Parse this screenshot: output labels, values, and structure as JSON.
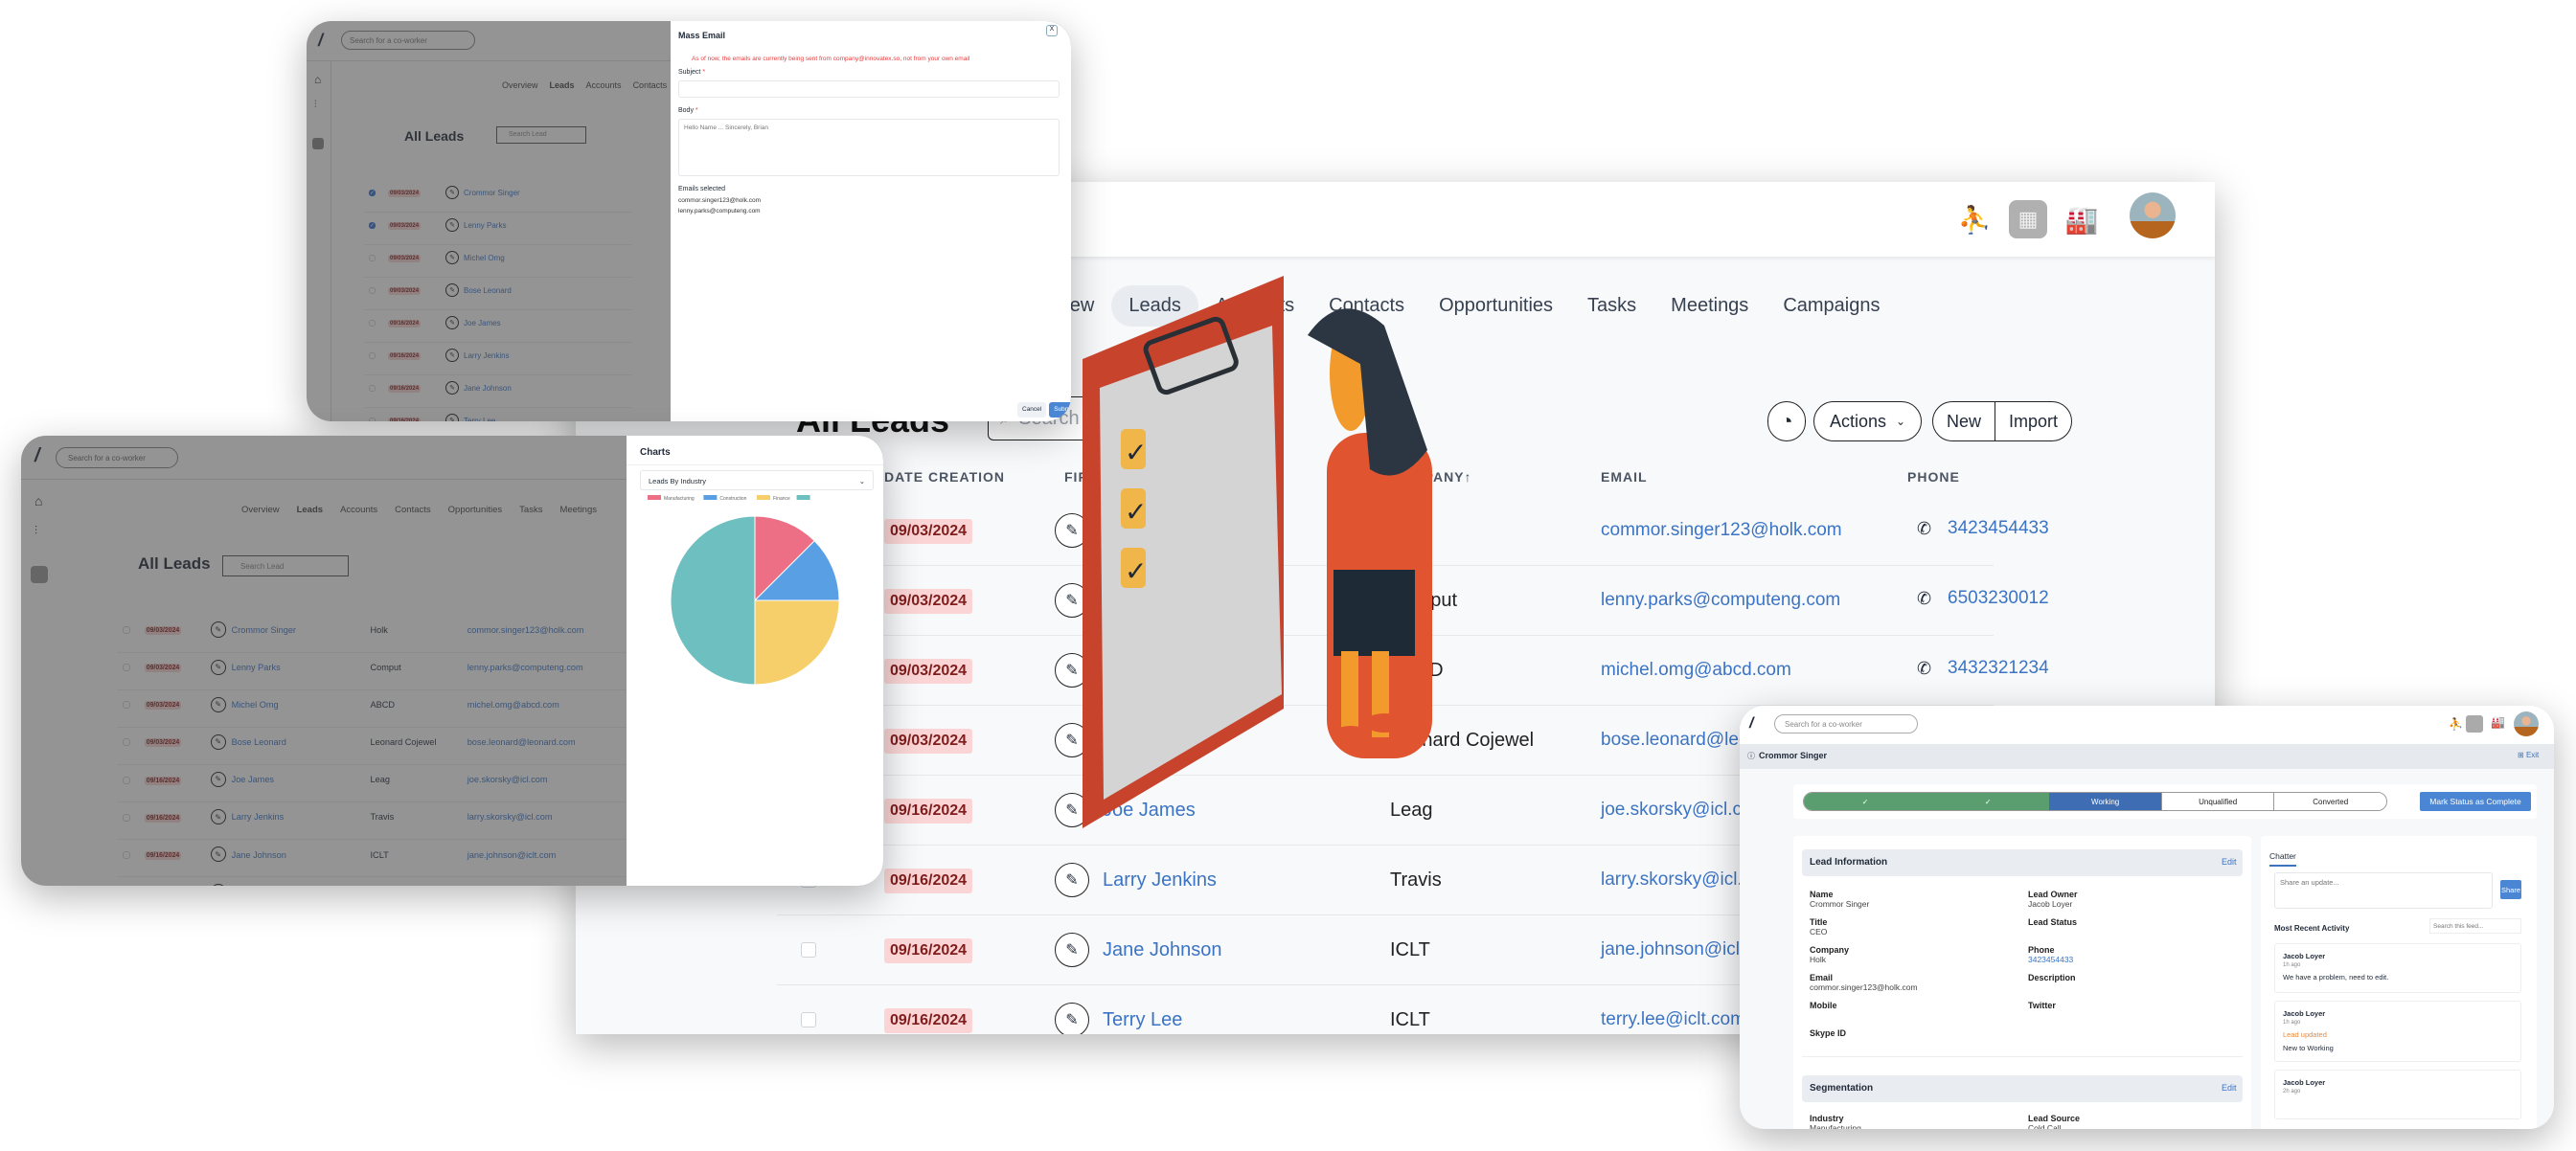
{
  "main_window": {
    "header_icons": [
      "hand-person-icon",
      "analytics-icon",
      "factory-icon",
      "user-avatar"
    ],
    "nav_tabs": [
      {
        "label": "Overview",
        "active": false
      },
      {
        "label": "Leads",
        "active": true
      },
      {
        "label": "Accounts",
        "active": false
      },
      {
        "label": "Contacts",
        "active": false
      },
      {
        "label": "Opportunities",
        "active": false
      },
      {
        "label": "Tasks",
        "active": false
      },
      {
        "label": "Meetings",
        "active": false
      },
      {
        "label": "Campaigns",
        "active": false
      }
    ],
    "list_title": "All Leads",
    "search_placeholder": "Search Lead",
    "actions_label": "Actions",
    "new_label": "New",
    "import_label": "Import",
    "columns": [
      "DATE CREATION",
      "FIRST NAME",
      "COMPANY",
      "EMAIL",
      "PHONE"
    ],
    "sort_indicator": "↑",
    "rows": [
      {
        "date": "09/03/2024",
        "name": "Crommor Singer",
        "company": "Holk",
        "email": "commor.singer123@holk.com",
        "phone": "3423454433",
        "checked": true
      },
      {
        "date": "09/03/2024",
        "name": "Lenny Parks",
        "company": "Comput",
        "email": "lenny.parks@computeng.com",
        "phone": "6503230012",
        "checked": true
      },
      {
        "date": "09/03/2024",
        "name": "Michel Omg",
        "company": "ABCD",
        "email": "michel.omg@abcd.com",
        "phone": "3432321234",
        "checked": false
      },
      {
        "date": "09/03/2024",
        "name": "Bose Leonard",
        "company": "Leonard Cojewel",
        "email": "bose.leonard@leonard.com",
        "phone": "",
        "checked": false
      },
      {
        "date": "09/16/2024",
        "name": "Joe James",
        "company": "Leag",
        "email": "joe.skorsky@icl.com",
        "phone": "",
        "checked": false
      },
      {
        "date": "09/16/2024",
        "name": "Larry Jenkins",
        "company": "Travis",
        "email": "larry.skorsky@icl.com",
        "phone": "",
        "checked": false
      },
      {
        "date": "09/16/2024",
        "name": "Jane Johnson",
        "company": "ICLT",
        "email": "jane.johnson@iclt.com",
        "phone": "",
        "checked": false
      },
      {
        "date": "09/16/2024",
        "name": "Terry Lee",
        "company": "ICLT",
        "email": "terry.lee@iclt.com",
        "phone": "",
        "checked": false
      }
    ]
  },
  "coworker_search_placeholder": "Search for a co-worker",
  "mass_email": {
    "title": "Mass Email",
    "close_label": "X",
    "warning": "As of now, the emails are currently being sent from company@innovatex.so, not from your own email",
    "subject_label": "Subject",
    "body_label": "Body",
    "required_mark": "*",
    "body_placeholder": "Hello Name ... Sincerely, Brian",
    "emails_selected_label": "Emails selected",
    "emails_selected": [
      "commor.singer123@holk.com",
      "lenny.parks@computeng.com"
    ],
    "cancel_label": "Cancel",
    "submit_label": "Submit"
  },
  "charts_panel": {
    "title": "Charts",
    "select_value": "Leads By Industry"
  },
  "chart_data": {
    "type": "pie",
    "title": "Leads By Industry",
    "categories": [
      "Manufacturing",
      "Construction",
      "Finance",
      ""
    ],
    "values": [
      12.5,
      12.5,
      25,
      50
    ],
    "colors": [
      "#ec6f85",
      "#589fe3",
      "#f6cf6a",
      "#6ebfbf"
    ],
    "legend": "top"
  },
  "lead_detail": {
    "record_name": "Crommor Singer",
    "exit_label": "Exit",
    "stages": [
      {
        "label": "✓",
        "state": "done"
      },
      {
        "label": "✓",
        "state": "done"
      },
      {
        "label": "Working",
        "state": "current"
      },
      {
        "label": "Unqualified",
        "state": "todo"
      },
      {
        "label": "Converted",
        "state": "todo"
      }
    ],
    "mark_complete_label": "Mark Status as Complete",
    "lead_info_title": "Lead Information",
    "edit_label": "Edit",
    "fields_left": [
      {
        "label": "Name",
        "value": "Crommor Singer"
      },
      {
        "label": "Title",
        "value": "CEO"
      },
      {
        "label": "Company",
        "value": "Holk"
      },
      {
        "label": "Email",
        "value": "commor.singer123@holk.com"
      },
      {
        "label": "Mobile",
        "value": ""
      },
      {
        "label": "Skype ID",
        "value": ""
      }
    ],
    "fields_right": [
      {
        "label": "Lead Owner",
        "value": "Jacob Loyer"
      },
      {
        "label": "Lead Status",
        "value": ""
      },
      {
        "label": "Phone",
        "value": "3423454433"
      },
      {
        "label": "Description",
        "value": ""
      },
      {
        "label": "Twitter",
        "value": ""
      }
    ],
    "segmentation_title": "Segmentation",
    "segmentation_fields": [
      {
        "label": "Industry",
        "value": "Manufacturing"
      },
      {
        "label": "Lead Source",
        "value": "Cold Call"
      }
    ],
    "chatter_tab": "Chatter",
    "share_placeholder": "Share an update...",
    "share_label": "Share",
    "recent_activity_label": "Most Recent Activity",
    "feed_search_placeholder": "Search this feed...",
    "activities": [
      {
        "author": "Jacob Loyer",
        "time": "1h ago",
        "highlight": "",
        "text": "We have a problem, need to edit."
      },
      {
        "author": "Jacob Loyer",
        "time": "1h ago",
        "highlight": "Lead updated",
        "text": "New to Working"
      },
      {
        "author": "Jacob Loyer",
        "time": "2h ago",
        "highlight": "",
        "text": ""
      }
    ]
  }
}
